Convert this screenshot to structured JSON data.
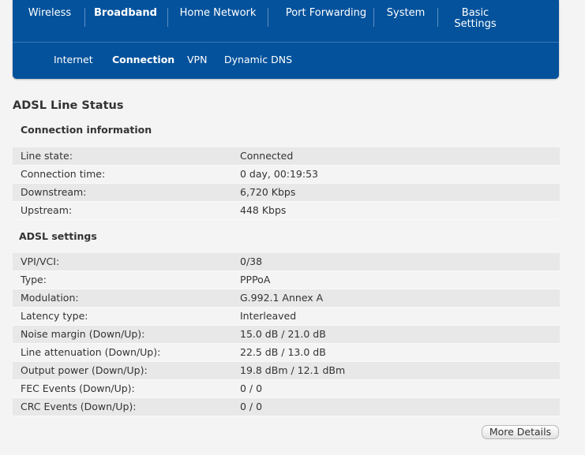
{
  "nav": {
    "main_tabs": [
      {
        "label": "Wireless"
      },
      {
        "label": "Broadband"
      },
      {
        "label": "Home Network"
      },
      {
        "label": "Port Forwarding"
      },
      {
        "label": "System"
      },
      {
        "label": "Basic\nSettings"
      }
    ],
    "active_main": "Broadband",
    "sub_tabs": [
      {
        "label": "Internet"
      },
      {
        "label": "Connection"
      },
      {
        "label": "VPN"
      },
      {
        "label": "Dynamic DNS"
      }
    ],
    "active_sub": "Connection"
  },
  "page": {
    "title": "ADSL Line Status"
  },
  "connection_info": {
    "title": "Connection information",
    "rows": [
      {
        "label": "Line state:",
        "value": "Connected"
      },
      {
        "label": "Connection time:",
        "value": "0 day, 00:19:53"
      },
      {
        "label": "Downstream:",
        "value": "6,720 Kbps"
      },
      {
        "label": "Upstream:",
        "value": "448 Kbps"
      }
    ]
  },
  "adsl_settings": {
    "title": "ADSL settings",
    "rows": [
      {
        "label": "VPI/VCI:",
        "value": "0/38"
      },
      {
        "label": "Type:",
        "value": "PPPoA"
      },
      {
        "label": "Modulation:",
        "value": "G.992.1 Annex A"
      },
      {
        "label": "Latency type:",
        "value": "Interleaved"
      },
      {
        "label": "Noise margin (Down/Up):",
        "value": "15.0 dB / 21.0 dB"
      },
      {
        "label": "Line attenuation (Down/Up):",
        "value": "22.5 dB / 13.0 dB"
      },
      {
        "label": "Output power (Down/Up):",
        "value": "19.8 dBm / 12.1 dBm"
      },
      {
        "label": "FEC Events (Down/Up):",
        "value": "0 / 0"
      },
      {
        "label": "CRC Events (Down/Up):",
        "value": "0 / 0"
      }
    ]
  },
  "buttons": {
    "more_details": "More Details"
  },
  "colors": {
    "nav_bg": "#04529c",
    "row_alt": "#e8e8e8",
    "page_bg": "#f4f4f4"
  }
}
